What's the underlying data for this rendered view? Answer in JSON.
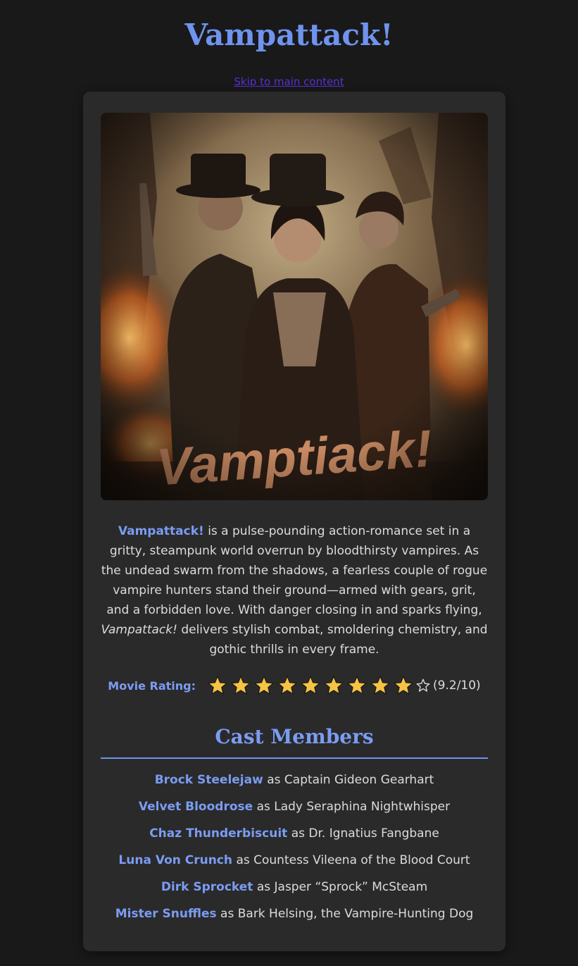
{
  "page": {
    "title": "Vampattack!",
    "skip_link": "Skip to main content"
  },
  "poster": {
    "title_text": "Vamptiack!",
    "icon": "movie-poster-image"
  },
  "description": {
    "title_highlight": "Vampattack!",
    "part1": " is a pulse-pounding action-romance set in a gritty, steampunk world overrun by bloodthirsty vampires. As the undead swarm from the shadows, a fearless couple of rogue vampire hunters stand their ground—armed with gears, grit, and a forbidden love. With danger closing in and sparks flying, ",
    "title_italic": "Vampattack!",
    "part2": " delivers stylish combat, smoldering chemistry, and gothic thrills in every frame."
  },
  "rating": {
    "label": "Movie Rating:",
    "filled_stars": 9,
    "total_stars": 10,
    "value_text": "(9.2/10)",
    "star_color": "#f6c343"
  },
  "cast": {
    "heading": "Cast Members",
    "connector": "as",
    "members": [
      {
        "actor": "Brock Steelejaw",
        "role": "Captain Gideon Gearhart"
      },
      {
        "actor": "Velvet Bloodrose",
        "role": "Lady Seraphina Nightwhisper"
      },
      {
        "actor": "Chaz Thunderbiscuit",
        "role": "Dr. Ignatius Fangbane"
      },
      {
        "actor": "Luna Von Crunch",
        "role": "Countess Vileena of the Blood Court"
      },
      {
        "actor": "Dirk Sprocket",
        "role": "Jasper “Sprock” McSteam"
      },
      {
        "actor": "Mister Snuffles",
        "role": "Bark Helsing, the Vampire-Hunting Dog"
      }
    ]
  },
  "colors": {
    "background": "#191919",
    "card": "#2a2a2a",
    "accent": "#6f93ee",
    "text": "#dcdcdc",
    "skip_link": "#5a2ed3"
  }
}
